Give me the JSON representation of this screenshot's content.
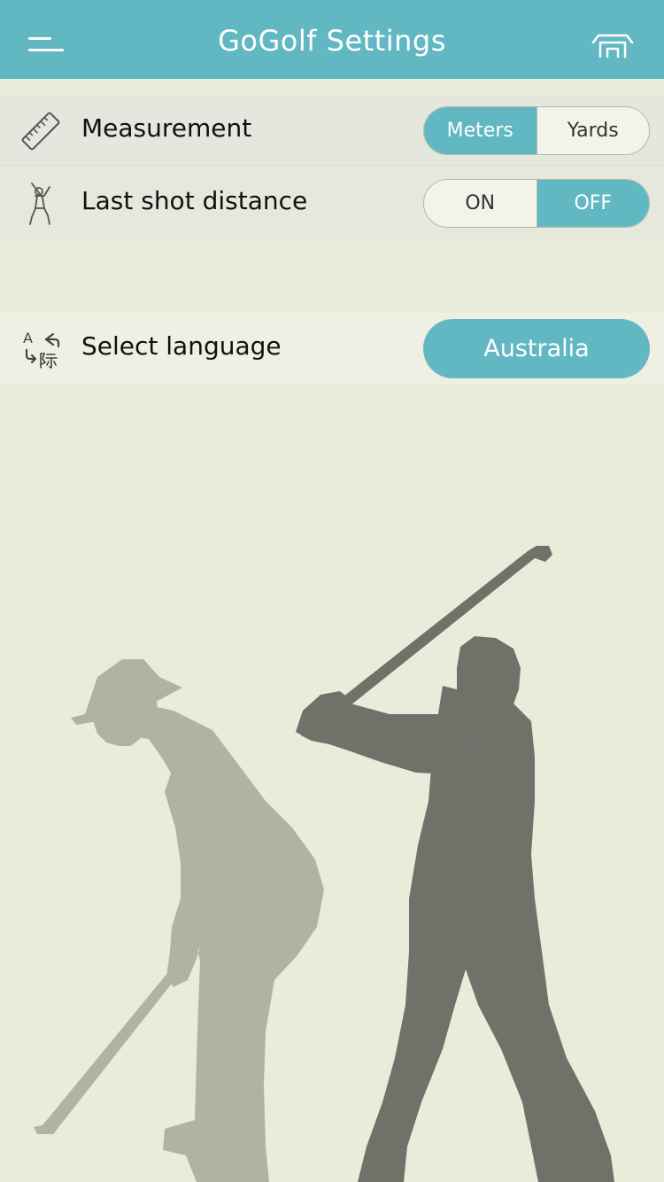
{
  "header": {
    "title": "GoGolf Settings",
    "menu_icon": "hamburger-menu-icon",
    "home_icon": "home-icon",
    "background_color": "#61b8c3"
  },
  "settings": {
    "measurement": {
      "icon": "ruler-icon",
      "label": "Measurement",
      "options": [
        "Meters",
        "Yards"
      ],
      "selected": "Meters"
    },
    "last_shot_distance": {
      "icon": "golfer-icon",
      "label": "Last shot distance",
      "options": [
        "ON",
        "OFF"
      ],
      "selected": "OFF"
    },
    "language": {
      "icon": "translate-icon",
      "label": "Select language",
      "value": "Australia"
    }
  },
  "colors": {
    "accent": "#61b8c3",
    "background": "#ebebdb",
    "silhouette_light": "#b2b2a4",
    "silhouette_dark": "#71716a"
  }
}
